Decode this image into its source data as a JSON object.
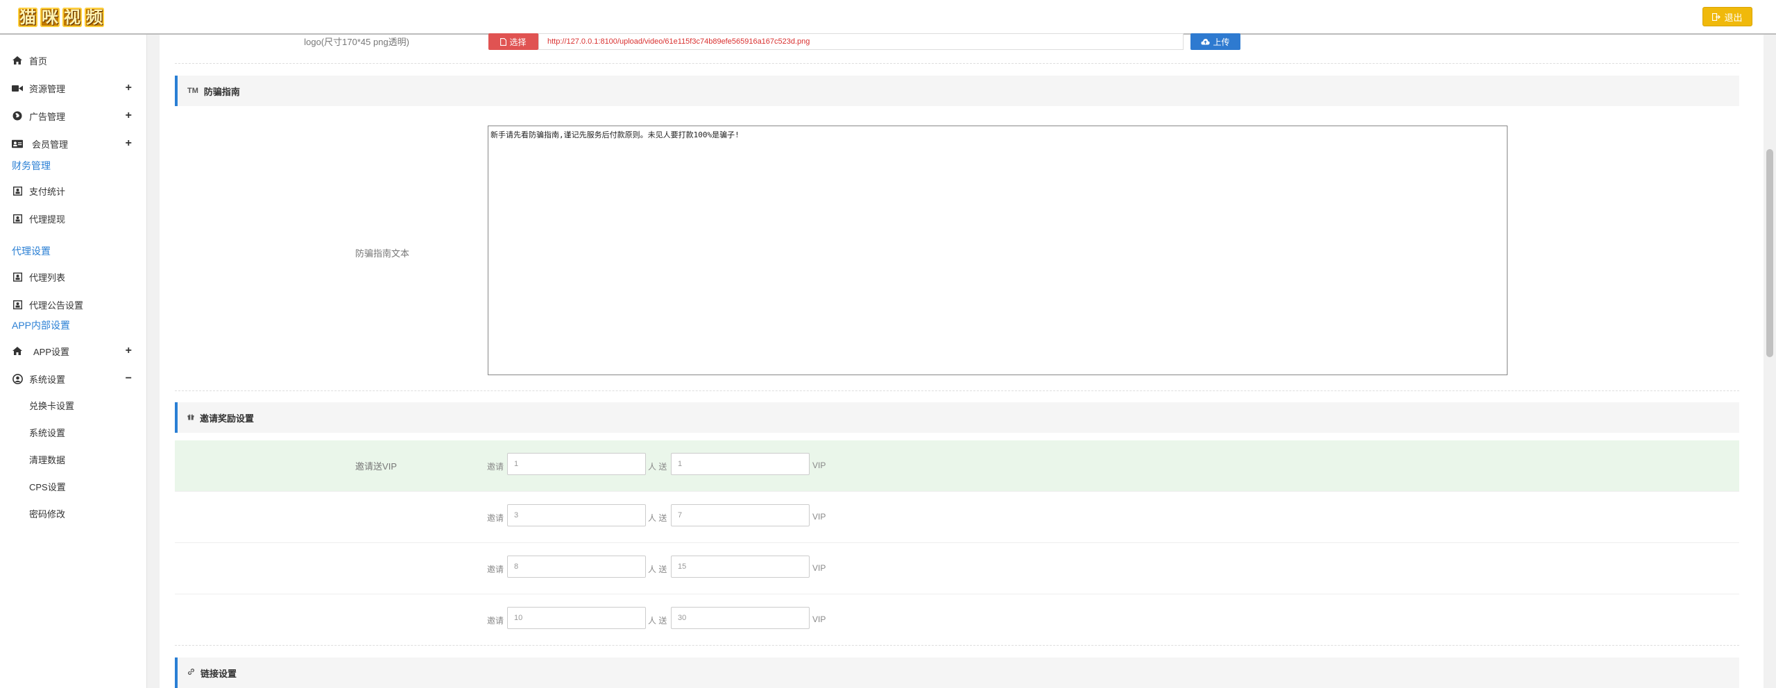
{
  "header": {
    "logo_chars": [
      "猫",
      "咪",
      "视",
      "频"
    ],
    "logout_label": "退出"
  },
  "sidebar": {
    "home": "首页",
    "resource": "资源管理",
    "ads": "广告管理",
    "members": "会员管理",
    "finance_section": "财务管理",
    "pay_stats": "支付统计",
    "agent_withdraw": "代理提现",
    "agent_section": "代理设置",
    "agent_list": "代理列表",
    "agent_notice": "代理公告设置",
    "app_section": "APP内部设置",
    "app_settings": "APP设置",
    "system": "系统设置",
    "sub": [
      "兑换卡设置",
      "系统设置",
      "清理数据",
      "CPS设置",
      "密码修改"
    ],
    "plus": "+",
    "minus": "−"
  },
  "logo_row": {
    "label": "logo(尺寸170*45 png透明)",
    "choose_label": "选择",
    "url_value": "http://127.0.0.1:8100/upload/video/61e115f3c74b89efe565916a167c523d.png",
    "upload_label": "上传"
  },
  "antifraud": {
    "header": "防骗指南",
    "header_icon": "TM",
    "row_label": "防骗指南文本",
    "text": "新手请先看防骗指南,谨记先服务后付款原则。未见人要打款100%是骗子!"
  },
  "invite": {
    "header": "邀请奖励设置",
    "row_label": "邀请送VIP",
    "invite_word": "邀请",
    "person_word": "人 送",
    "vip_word": "VIP",
    "rows": [
      {
        "invite": "1",
        "vip": "1"
      },
      {
        "invite": "3",
        "vip": "7"
      },
      {
        "invite": "8",
        "vip": "15"
      },
      {
        "invite": "10",
        "vip": "30"
      }
    ]
  },
  "links": {
    "header": "链接设置"
  },
  "colors": {
    "accent": "#2a7fd4",
    "danger": "#e05352",
    "warning": "#f0b90b",
    "highlight_row": "#eaf6ea"
  }
}
